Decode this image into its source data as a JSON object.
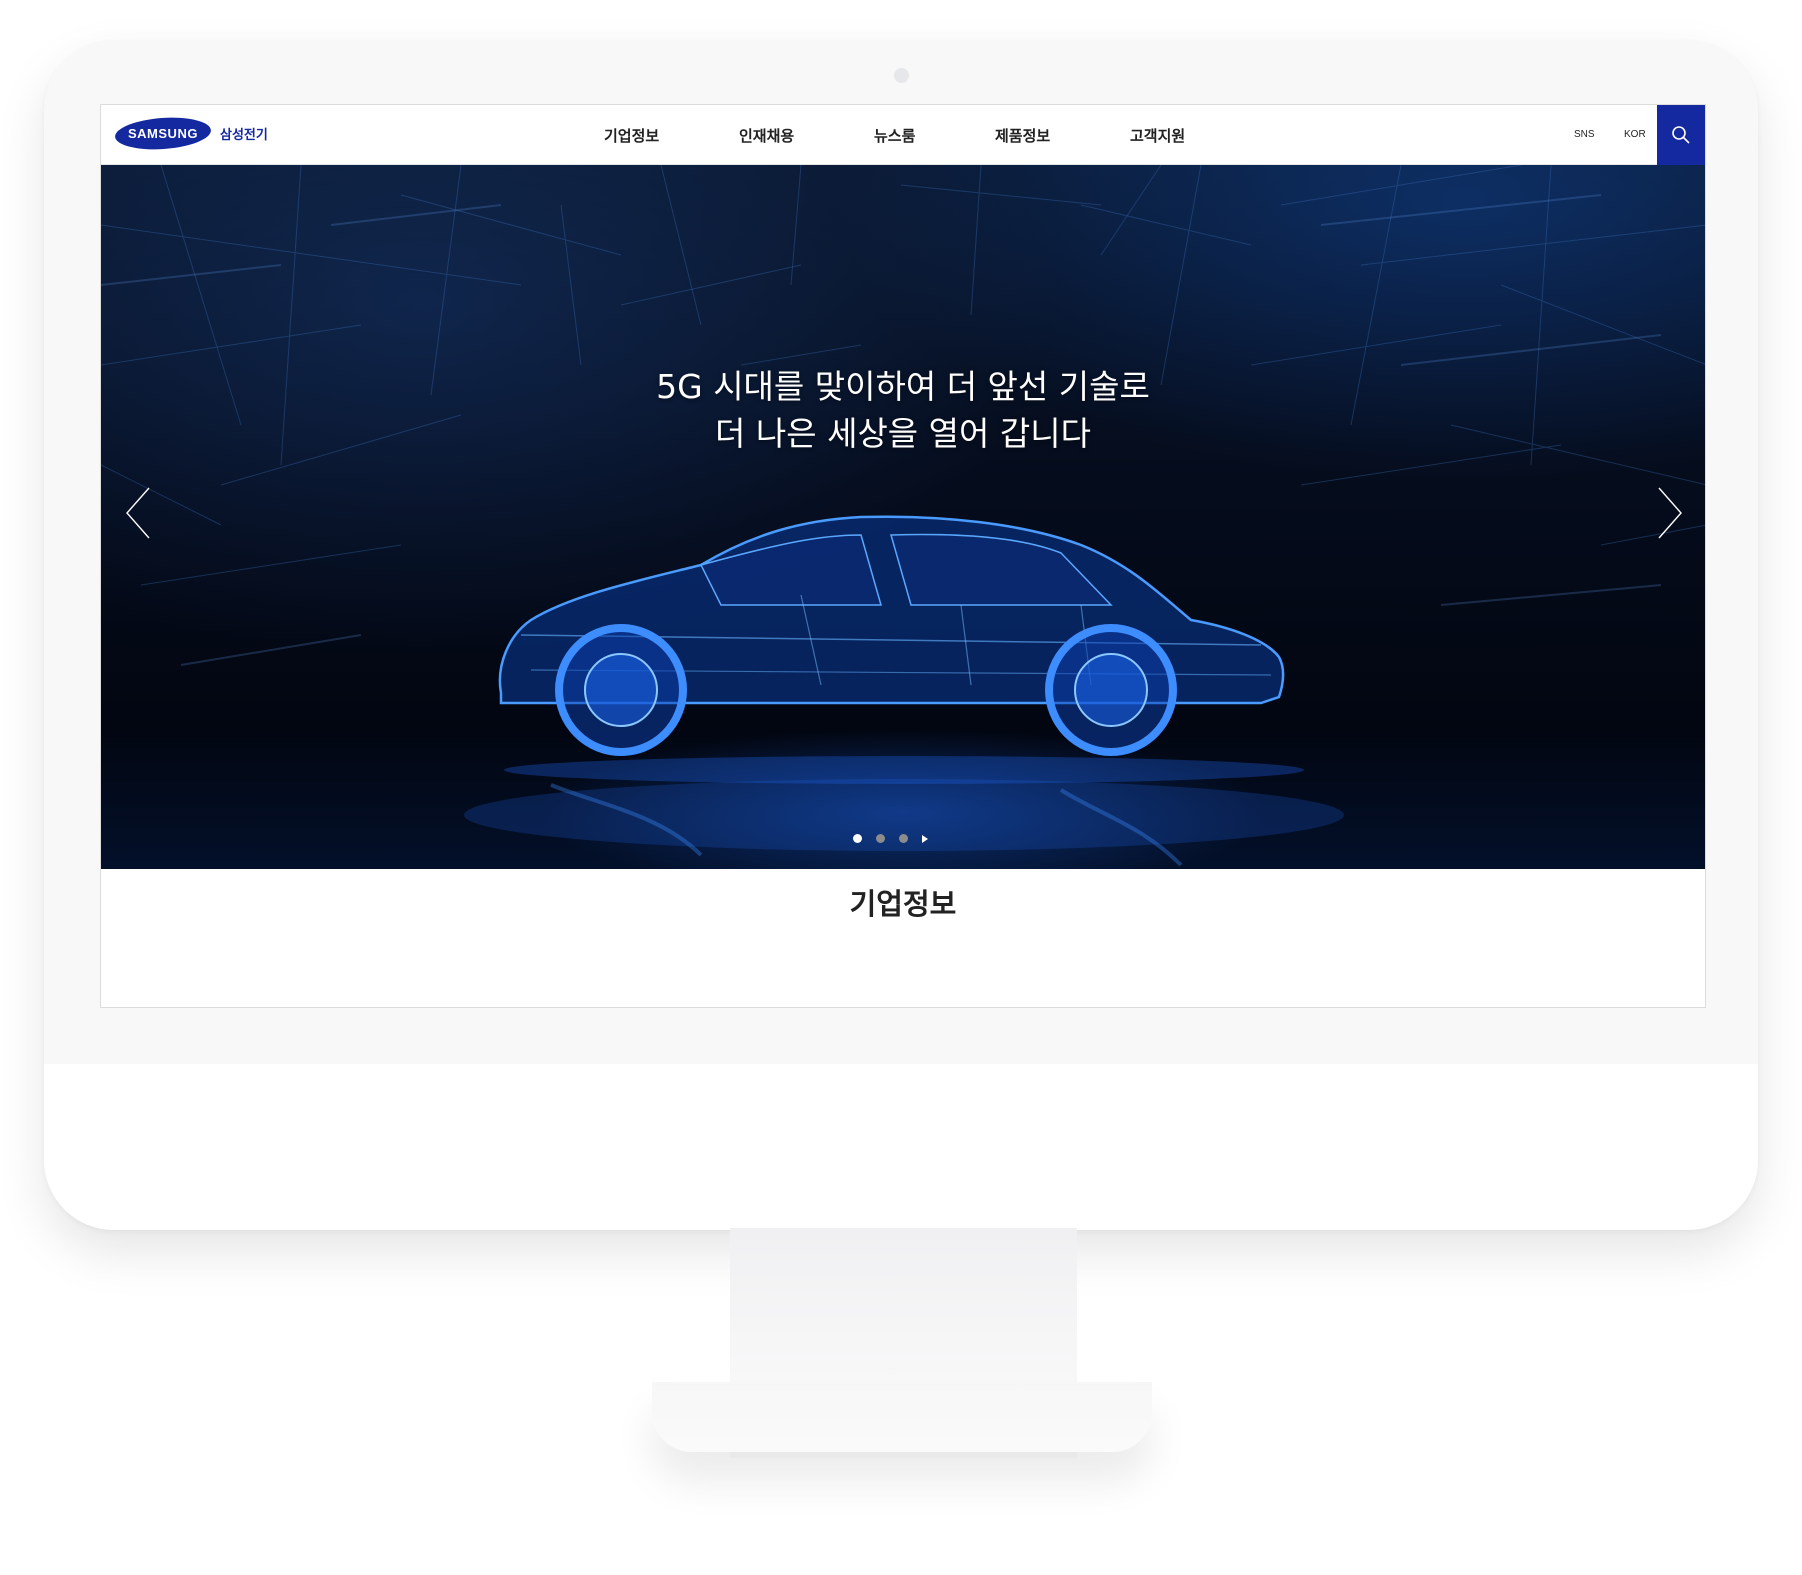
{
  "header": {
    "logo_text": "SAMSUNG",
    "logo_sub": "삼성전기",
    "nav": [
      "기업정보",
      "인재채용",
      "뉴스룸",
      "제품정보",
      "고객지원"
    ],
    "util_sns": "SNS",
    "util_lang": "KOR",
    "search_icon": "search-icon"
  },
  "hero": {
    "headline_line1": "5G 시대를 맞이하여 더 앞선 기술로",
    "headline_line2": "더 나은 세상을 열어 갑니다",
    "slides_total": 3,
    "active_slide": 1,
    "prev_icon": "chevron-left-icon",
    "next_icon": "chevron-right-icon",
    "play_icon": "play-icon"
  },
  "section": {
    "title": "기업정보"
  },
  "colors": {
    "brand": "#1428a0",
    "hero_bg": "#050c1c",
    "car_glow": "#2f7bff"
  }
}
